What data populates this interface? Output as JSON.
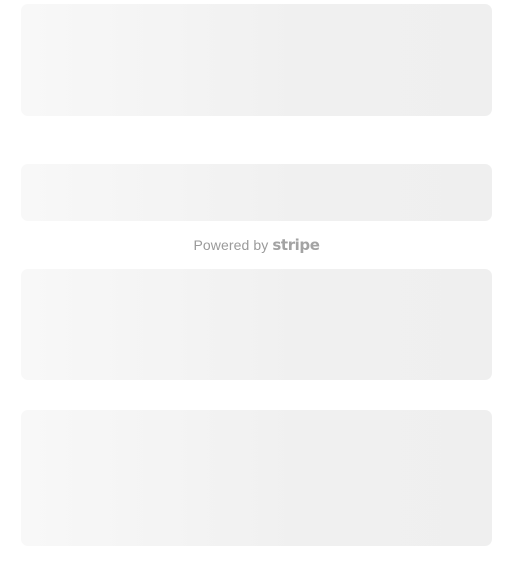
{
  "footer": {
    "powered_label": "Powered by",
    "brand": "stripe"
  },
  "colors": {
    "skeleton_light": "#f8f8f8",
    "skeleton_dark": "#efefef",
    "footer_text": "#9a9a9a"
  }
}
